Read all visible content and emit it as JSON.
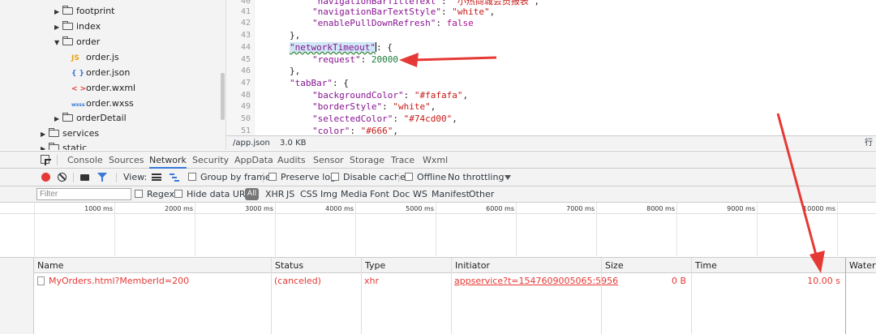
{
  "file_tree": {
    "items": [
      {
        "label": "footprint",
        "expanded": false,
        "type": "folder"
      },
      {
        "label": "index",
        "expanded": false,
        "type": "folder"
      },
      {
        "label": "order",
        "expanded": true,
        "type": "folder"
      },
      {
        "label": "order.js",
        "type": "js",
        "icon_text": "JS"
      },
      {
        "label": "order.json",
        "type": "json",
        "icon_text": "{ }"
      },
      {
        "label": "order.wxml",
        "type": "wxml",
        "icon_text": "< >"
      },
      {
        "label": "order.wxss",
        "type": "wxss",
        "icon_text": "wxss"
      },
      {
        "label": "orderDetail",
        "expanded": false,
        "type": "folder"
      },
      {
        "label": "services",
        "expanded": false,
        "type": "folder"
      },
      {
        "label": "static",
        "expanded": false,
        "type": "folder"
      }
    ]
  },
  "editor": {
    "line_numbers": [
      "40",
      "41",
      "42",
      "43",
      "44",
      "45",
      "46",
      "47",
      "48",
      "49",
      "50",
      "51"
    ],
    "lines": [
      {
        "key": "\"navigationBarTitleText\"",
        "sep": ": ",
        "val": "\"小热商城会员报表\"",
        "val_type": "str",
        "tail": ","
      },
      {
        "key": "\"navigationBarTextStyle\"",
        "sep": ": ",
        "val": "\"white\"",
        "val_type": "str",
        "tail": ","
      },
      {
        "key": "\"enablePullDownRefresh\"",
        "sep": ": ",
        "val": "false",
        "val_type": "kw",
        "tail": ""
      },
      {
        "key": "",
        "sep": "",
        "val": "},",
        "val_type": "plain",
        "tail": ""
      },
      {
        "key": "\"networkTimeout\"",
        "sep": ": ",
        "val": "{",
        "val_type": "plain",
        "tail": ""
      },
      {
        "key": "\"request\"",
        "sep": ": ",
        "val": "20000",
        "val_type": "num",
        "tail": ""
      },
      {
        "key": "",
        "sep": "",
        "val": "},",
        "val_type": "plain",
        "tail": ""
      },
      {
        "key": "\"tabBar\"",
        "sep": ": ",
        "val": "{",
        "val_type": "plain",
        "tail": ""
      },
      {
        "key": "\"backgroundColor\"",
        "sep": ": ",
        "val": "\"#fafafa\"",
        "val_type": "str",
        "tail": ","
      },
      {
        "key": "\"borderStyle\"",
        "sep": ": ",
        "val": "\"white\"",
        "val_type": "str",
        "tail": ","
      },
      {
        "key": "\"selectedColor\"",
        "sep": ": ",
        "val": "\"#74cd00\"",
        "val_type": "str",
        "tail": ","
      },
      {
        "key": "\"color\"",
        "sep": ": ",
        "val": "\"#666\"",
        "val_type": "str",
        "tail": ","
      }
    ],
    "status_file": "/app.json",
    "status_size": "3.0 KB",
    "status_right": "行"
  },
  "devtools": {
    "tabs": [
      "Console",
      "Sources",
      "Network",
      "Security",
      "AppData",
      "Audits",
      "Sensor",
      "Storage",
      "Trace",
      "Wxml"
    ],
    "active_tab": "Network",
    "toolbar": {
      "view_label": "View:",
      "group_by_frame": "Group by frame",
      "preserve_log": "Preserve log",
      "disable_cache": "Disable cache",
      "offline": "Offline",
      "throttling": "No throttling"
    },
    "filter": {
      "placeholder": "Filter",
      "regex": "Regex",
      "hide_data_urls": "Hide data URLs",
      "all": "All",
      "types": [
        "XHR",
        "JS",
        "CSS",
        "Img",
        "Media",
        "Font",
        "Doc",
        "WS",
        "Manifest",
        "Other"
      ]
    },
    "timeline_ticks": [
      "1000 ms",
      "2000 ms",
      "3000 ms",
      "4000 ms",
      "5000 ms",
      "6000 ms",
      "7000 ms",
      "8000 ms",
      "9000 ms",
      "10000 ms"
    ],
    "columns": [
      "Name",
      "Status",
      "Type",
      "Initiator",
      "Size",
      "Time",
      "Waterfa"
    ],
    "rows": [
      {
        "name": "MyOrders.html?MemberId=200",
        "status": "(canceled)",
        "type": "xhr",
        "initiator": "appservice?t=1547609005065:5956",
        "size": "0 B",
        "time": "10.00 s"
      }
    ]
  },
  "colors": {
    "error_text": "#e53935",
    "accent": "#3879d9",
    "annotation_arrow": "#e53935"
  }
}
